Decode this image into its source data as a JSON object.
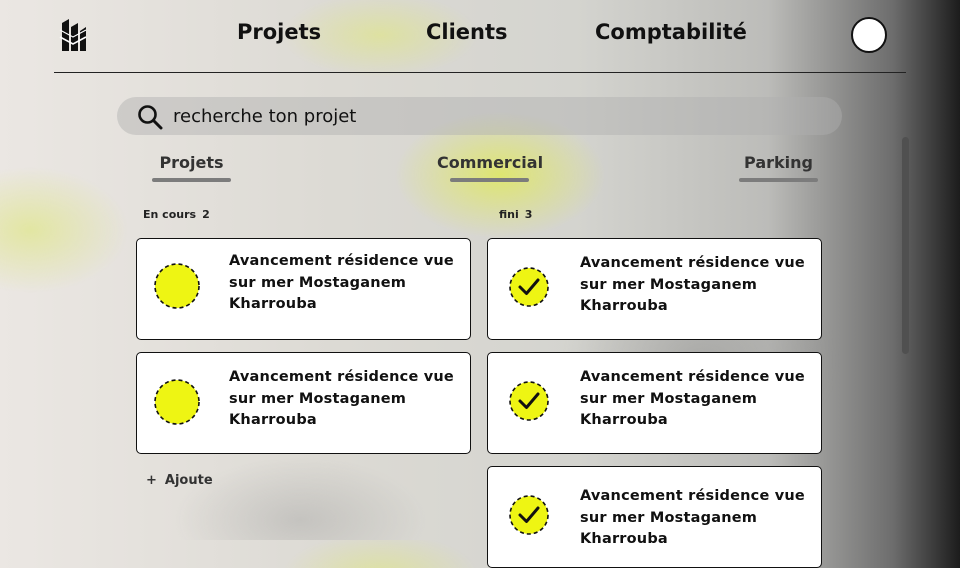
{
  "header": {
    "nav": [
      {
        "label": "Projets"
      },
      {
        "label": "Clients"
      },
      {
        "label": "Comptabilité"
      }
    ]
  },
  "search": {
    "placeholder": "recherche ton projet",
    "value": ""
  },
  "tabs": [
    {
      "label": "Projets"
    },
    {
      "label": "Commercial"
    },
    {
      "label": "Parking"
    }
  ],
  "columns": [
    {
      "title": "En cours",
      "count": "2",
      "status": "in-progress",
      "cards": [
        {
          "title": "Avancement résidence vue sur mer Mostaganem Kharrouba"
        },
        {
          "title": "Avancement résidence vue sur mer Mostaganem Kharrouba"
        }
      ],
      "add_label": "Ajoute"
    },
    {
      "title": "fini",
      "count": "3",
      "status": "done",
      "cards": [
        {
          "title": "Avancement résidence vue sur mer Mostaganem Kharrouba"
        },
        {
          "title": "Avancement résidence vue sur mer Mostaganem Kharrouba"
        },
        {
          "title": "Avancement résidence vue sur mer Mostaganem Kharrouba"
        }
      ]
    }
  ],
  "colors": {
    "accent_yellow": "#eef513",
    "text": "#111111",
    "card_background": "#ffffff",
    "tab_underline": "#7c7c7c"
  },
  "icons": {
    "logo": "building-logo-icon",
    "search": "search-icon",
    "in_progress": "dashed-circle-icon",
    "done": "check-circle-icon",
    "add": "plus-icon",
    "avatar": "avatar-circle"
  }
}
